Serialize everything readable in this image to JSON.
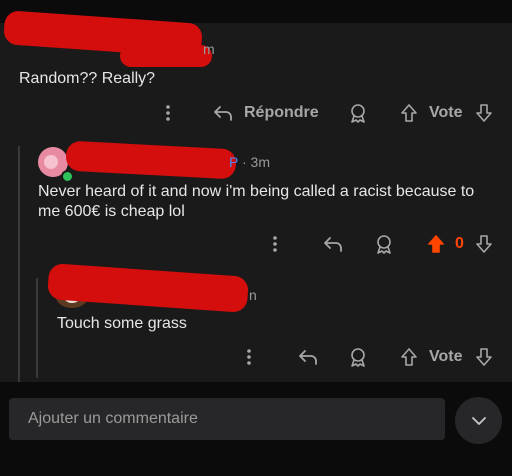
{
  "comments": [
    {
      "age_fragment": "m",
      "text": "Random?? Really?",
      "actions": {
        "reply_label": "Répondre",
        "vote_label": "Vote"
      }
    },
    {
      "age_fragment": "P · 3m",
      "online": true,
      "text_line1": "Never heard of it and now i'm being called a racist because to",
      "text_line2": "me 600€ is cheap lol",
      "actions": {
        "vote_count": "0",
        "upvoted": true
      }
    },
    {
      "age_fragment": "n",
      "text": "Touch some grass",
      "actions": {
        "vote_label": "Vote"
      }
    }
  ],
  "compose": {
    "placeholder": "Ajouter un commentaire"
  },
  "colors": {
    "upvote_active": "#ff4500",
    "redaction": "#d40d0d",
    "online": "#2ec25b"
  },
  "icons": [
    "more-vertical-icon",
    "reply-arrow-icon",
    "award-icon",
    "upvote-arrow-icon",
    "downvote-arrow-icon",
    "chevron-down-icon"
  ]
}
